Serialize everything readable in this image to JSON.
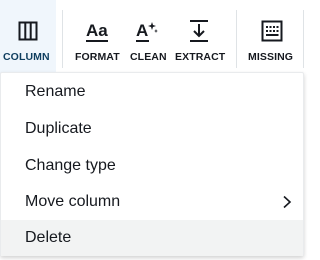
{
  "toolbar": {
    "items": [
      {
        "label": "COLUMN",
        "icon": "column-icon",
        "active": true
      },
      {
        "label": "FORMAT",
        "icon": "format-text-icon"
      },
      {
        "label": "CLEAN",
        "icon": "clean-sparkle-icon"
      },
      {
        "label": "EXTRACT",
        "icon": "extract-icon"
      },
      {
        "label": "MISSING",
        "icon": "missing-values-icon"
      }
    ]
  },
  "menu": {
    "items": [
      {
        "label": "Rename"
      },
      {
        "label": "Duplicate"
      },
      {
        "label": "Change type"
      },
      {
        "label": "Move column",
        "submenu": true
      },
      {
        "label": "Delete",
        "hovered": true
      }
    ]
  },
  "colors": {
    "active_bg": "#f0f6fc",
    "hover_bg": "#f2f3f3",
    "text": "#16191f",
    "separator": "#dfe3e6"
  }
}
